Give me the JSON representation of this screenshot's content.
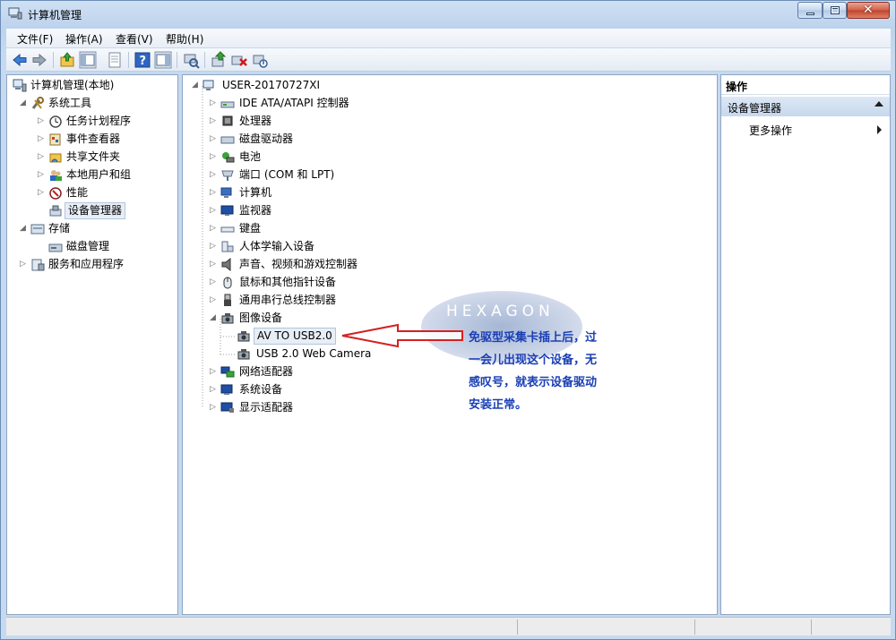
{
  "window": {
    "title": "计算机管理"
  },
  "menu": [
    "文件(F)",
    "操作(A)",
    "查看(V)",
    "帮助(H)"
  ],
  "toolbar_icons": [
    "back-icon",
    "forward-icon",
    "up-folder-icon",
    "show-hide-tree-icon",
    "properties-icon",
    "help-icon",
    "show-action-pane-icon",
    "scan-hardware-icon",
    "update-driver-icon",
    "uninstall-icon",
    "disable-icon"
  ],
  "left_tree": {
    "root": "计算机管理(本地)",
    "system_tools": "系统工具",
    "task_scheduler": "任务计划程序",
    "event_viewer": "事件查看器",
    "shared_folders": "共享文件夹",
    "local_users": "本地用户和组",
    "performance": "性能",
    "device_manager": "设备管理器",
    "storage": "存储",
    "disk_management": "磁盘管理",
    "services_apps": "服务和应用程序"
  },
  "device_tree": {
    "computer": "USER-20170727XI",
    "ide": "IDE ATA/ATAPI 控制器",
    "processor": "处理器",
    "disk_drives": "磁盘驱动器",
    "battery": "电池",
    "ports": "端口 (COM 和 LPT)",
    "computer_node": "计算机",
    "monitors": "监视器",
    "keyboard": "键盘",
    "hid": "人体学输入设备",
    "sound": "声音、视频和游戏控制器",
    "mice": "鼠标和其他指针设备",
    "usb": "通用串行总线控制器",
    "imaging": "图像设备",
    "av_to_usb": "AV TO USB2.0",
    "webcam": "USB 2.0 Web Camera",
    "network": "网络适配器",
    "system_devices": "系统设备",
    "display": "显示适配器"
  },
  "actions": {
    "header": "操作",
    "section": "设备管理器",
    "more": "更多操作"
  },
  "watermark": "HEXAGON",
  "annotation": "免驱型采集卡插上后，过一会儿出现这个设备，无感叹号，就表示设备驱动安装正常。"
}
